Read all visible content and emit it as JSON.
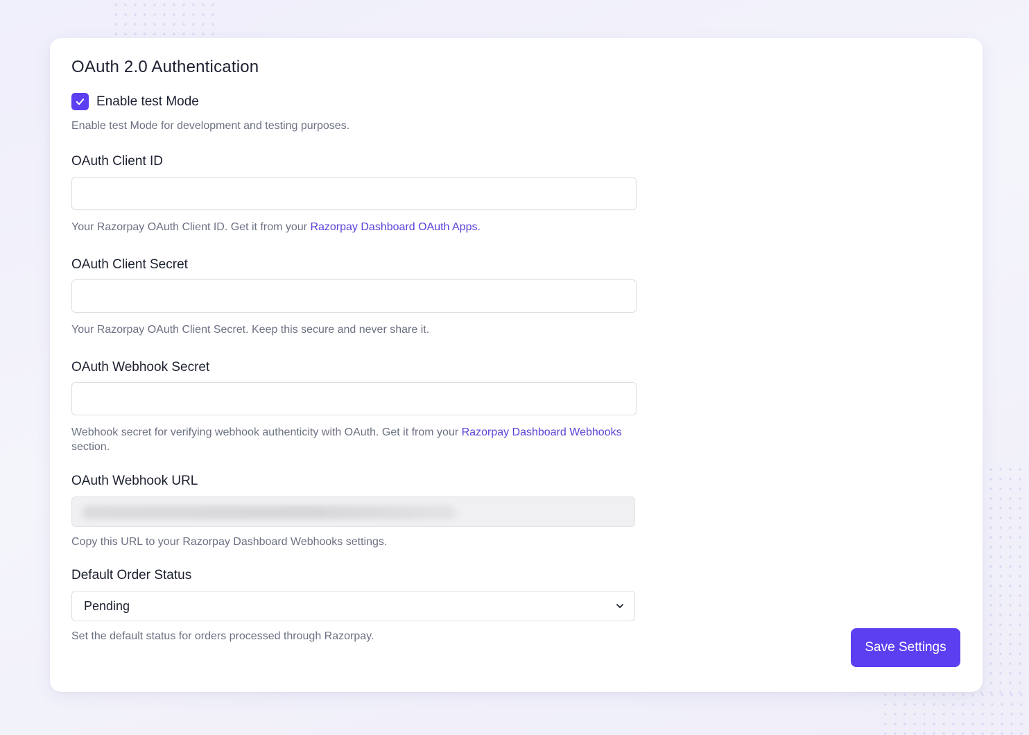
{
  "section": {
    "title": "OAuth 2.0 Authentication"
  },
  "test_mode": {
    "label": "Enable test Mode",
    "checked": true,
    "help": "Enable test Mode for development and testing purposes."
  },
  "client_id": {
    "label": "OAuth Client ID",
    "value": "",
    "help_prefix": "Your Razorpay OAuth Client ID. Get it from your ",
    "help_link": "Razorpay Dashboard OAuth Apps."
  },
  "client_secret": {
    "label": "OAuth Client Secret",
    "value": "",
    "help": "Your Razorpay OAuth Client Secret. Keep this secure and never share it."
  },
  "webhook_secret": {
    "label": "OAuth Webhook Secret",
    "value": "",
    "help_prefix": "Webhook secret for verifying webhook authenticity with OAuth. Get it from your ",
    "help_link": "Razorpay Dashboard Webhooks",
    "help_suffix": "section."
  },
  "webhook_url": {
    "label": "OAuth Webhook URL",
    "help": "Copy this URL to your Razorpay Dashboard Webhooks settings."
  },
  "order_status": {
    "label": "Default Order Status",
    "selected": "Pending",
    "help": "Set the default status for orders processed through Razorpay."
  },
  "actions": {
    "save_label": "Save Settings"
  },
  "colors": {
    "accent": "#5b3ff0",
    "link": "#5b3fd8",
    "help_text": "#6c7183",
    "readonly_bg": "#f0f0f2"
  },
  "icons": {
    "checkbox": "check-icon",
    "select": "chevron-down-icon"
  }
}
